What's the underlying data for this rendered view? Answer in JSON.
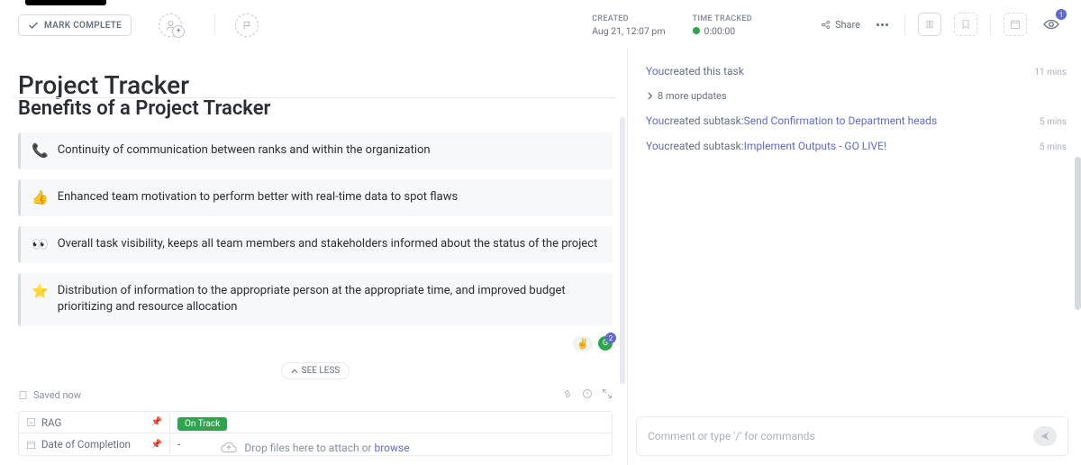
{
  "header": {
    "mark_complete": "MARK COMPLETE",
    "share": "Share",
    "created_label": "CREATED",
    "created_value": "Aug 21, 12:07 pm",
    "tracked_label": "TIME TRACKED",
    "tracked_value": "0:00:00",
    "watch_count": "1"
  },
  "title": "Project Tracker",
  "section_heading": "Benefits of a Project Tracker",
  "callouts": [
    {
      "icon": "📞",
      "text": "Continuity of communication between ranks and within the organization"
    },
    {
      "icon": "👍",
      "text": "Enhanced team motivation to perform better with real-time data to spot flaws"
    },
    {
      "icon": "👀",
      "text": "Overall task visibility, keeps all team members and stakeholders informed about the status of the project"
    },
    {
      "icon": "⭐",
      "text": "Distribution of information to the appropriate person at the appropriate time, and improved budget prioritizing and resource allocation"
    }
  ],
  "reactions": {
    "peace": "✌️",
    "count": "2"
  },
  "see_less": "SEE LESS",
  "saved": "Saved now",
  "fields": {
    "rag_label": "RAG",
    "rag_value": "On Track",
    "date_label": "Date of Completion",
    "date_value": "-"
  },
  "activity": {
    "you": "You",
    "items": [
      {
        "text": " created this task",
        "time": "11 mins"
      },
      {
        "expand": "8 more updates"
      },
      {
        "text": " created subtask: ",
        "link": "Send Confirmation to Department heads",
        "time": "5 mins"
      },
      {
        "text": " created subtask: ",
        "link": "Implement Outputs - GO LIVE!",
        "time": "5 mins"
      }
    ]
  },
  "footer": {
    "drop_prefix": "Drop files here to attach or ",
    "browse": "browse"
  },
  "comment": {
    "placeholder": "Comment or type '/' for commands"
  }
}
